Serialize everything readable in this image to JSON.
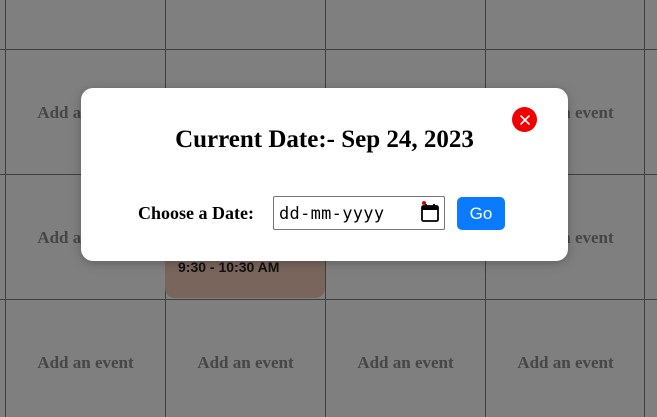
{
  "calendar": {
    "cell_label": "Add an event",
    "event": {
      "time": "9:30 - 10:30 AM"
    }
  },
  "modal": {
    "title": "Current Date:- Sep 24, 2023",
    "choose_label": "Choose a Date:",
    "date_placeholder": "dd-mm-yyyy",
    "go_label": "Go",
    "close_icon": "close-icon",
    "calendar_icon": "calendar-icon"
  },
  "colors": {
    "close_button": "#f00000",
    "go_button": "#0a7bff",
    "event_card": "#f4cbb9",
    "overlay": "rgba(0,0,0,0.5)"
  }
}
